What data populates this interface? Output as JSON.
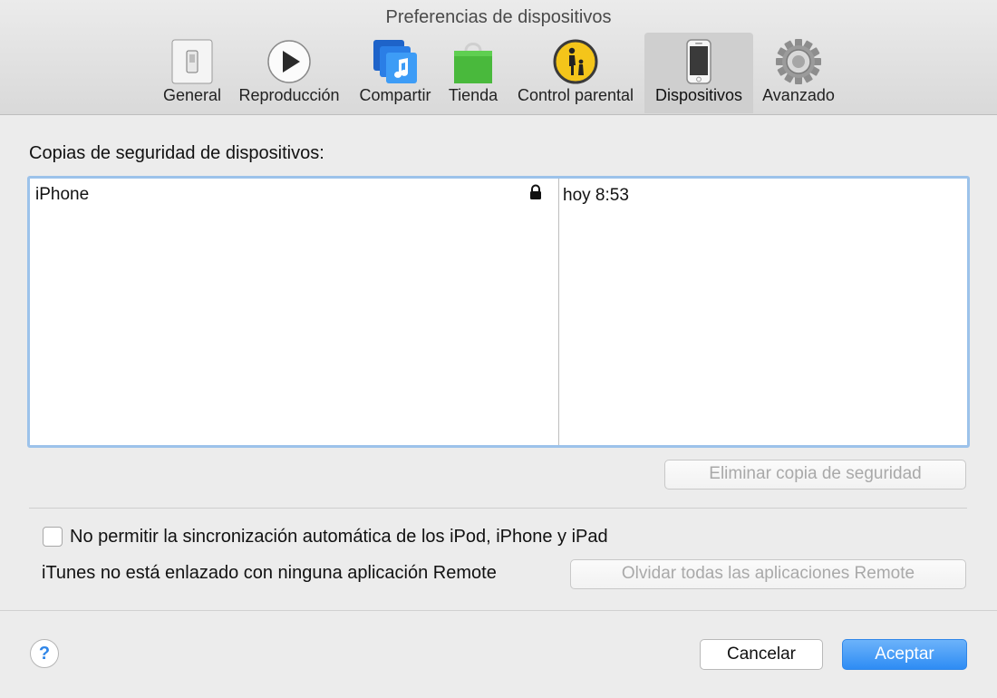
{
  "window": {
    "title": "Preferencias de dispositivos"
  },
  "toolbar": {
    "items": [
      {
        "label": "General",
        "icon": "switch-icon"
      },
      {
        "label": "Reproducción",
        "icon": "play-icon"
      },
      {
        "label": "Compartir",
        "icon": "music-share-icon"
      },
      {
        "label": "Tienda",
        "icon": "shopping-bag-icon"
      },
      {
        "label": "Control parental",
        "icon": "parental-control-icon"
      },
      {
        "label": "Dispositivos",
        "icon": "iphone-icon",
        "selected": true
      },
      {
        "label": "Avanzado",
        "icon": "gear-icon"
      }
    ]
  },
  "backups": {
    "title": "Copias de seguridad de dispositivos:",
    "rows": [
      {
        "name": "iPhone",
        "locked": true,
        "date": "hoy 8:53"
      }
    ],
    "delete_button": "Eliminar copia de seguridad"
  },
  "sync": {
    "checkbox_label": "No permitir la sincronización automática de los iPod, iPhone y iPad",
    "checked": false
  },
  "remote": {
    "text": "iTunes no está enlazado con ninguna aplicación Remote",
    "forget_button": "Olvidar todas las aplicaciones Remote"
  },
  "footer": {
    "help": "?",
    "cancel": "Cancelar",
    "accept": "Aceptar"
  },
  "colors": {
    "accent": "#2e8cf4",
    "selection_border": "#9cc2ea",
    "toolbar_bg": "#dcdcdc"
  }
}
